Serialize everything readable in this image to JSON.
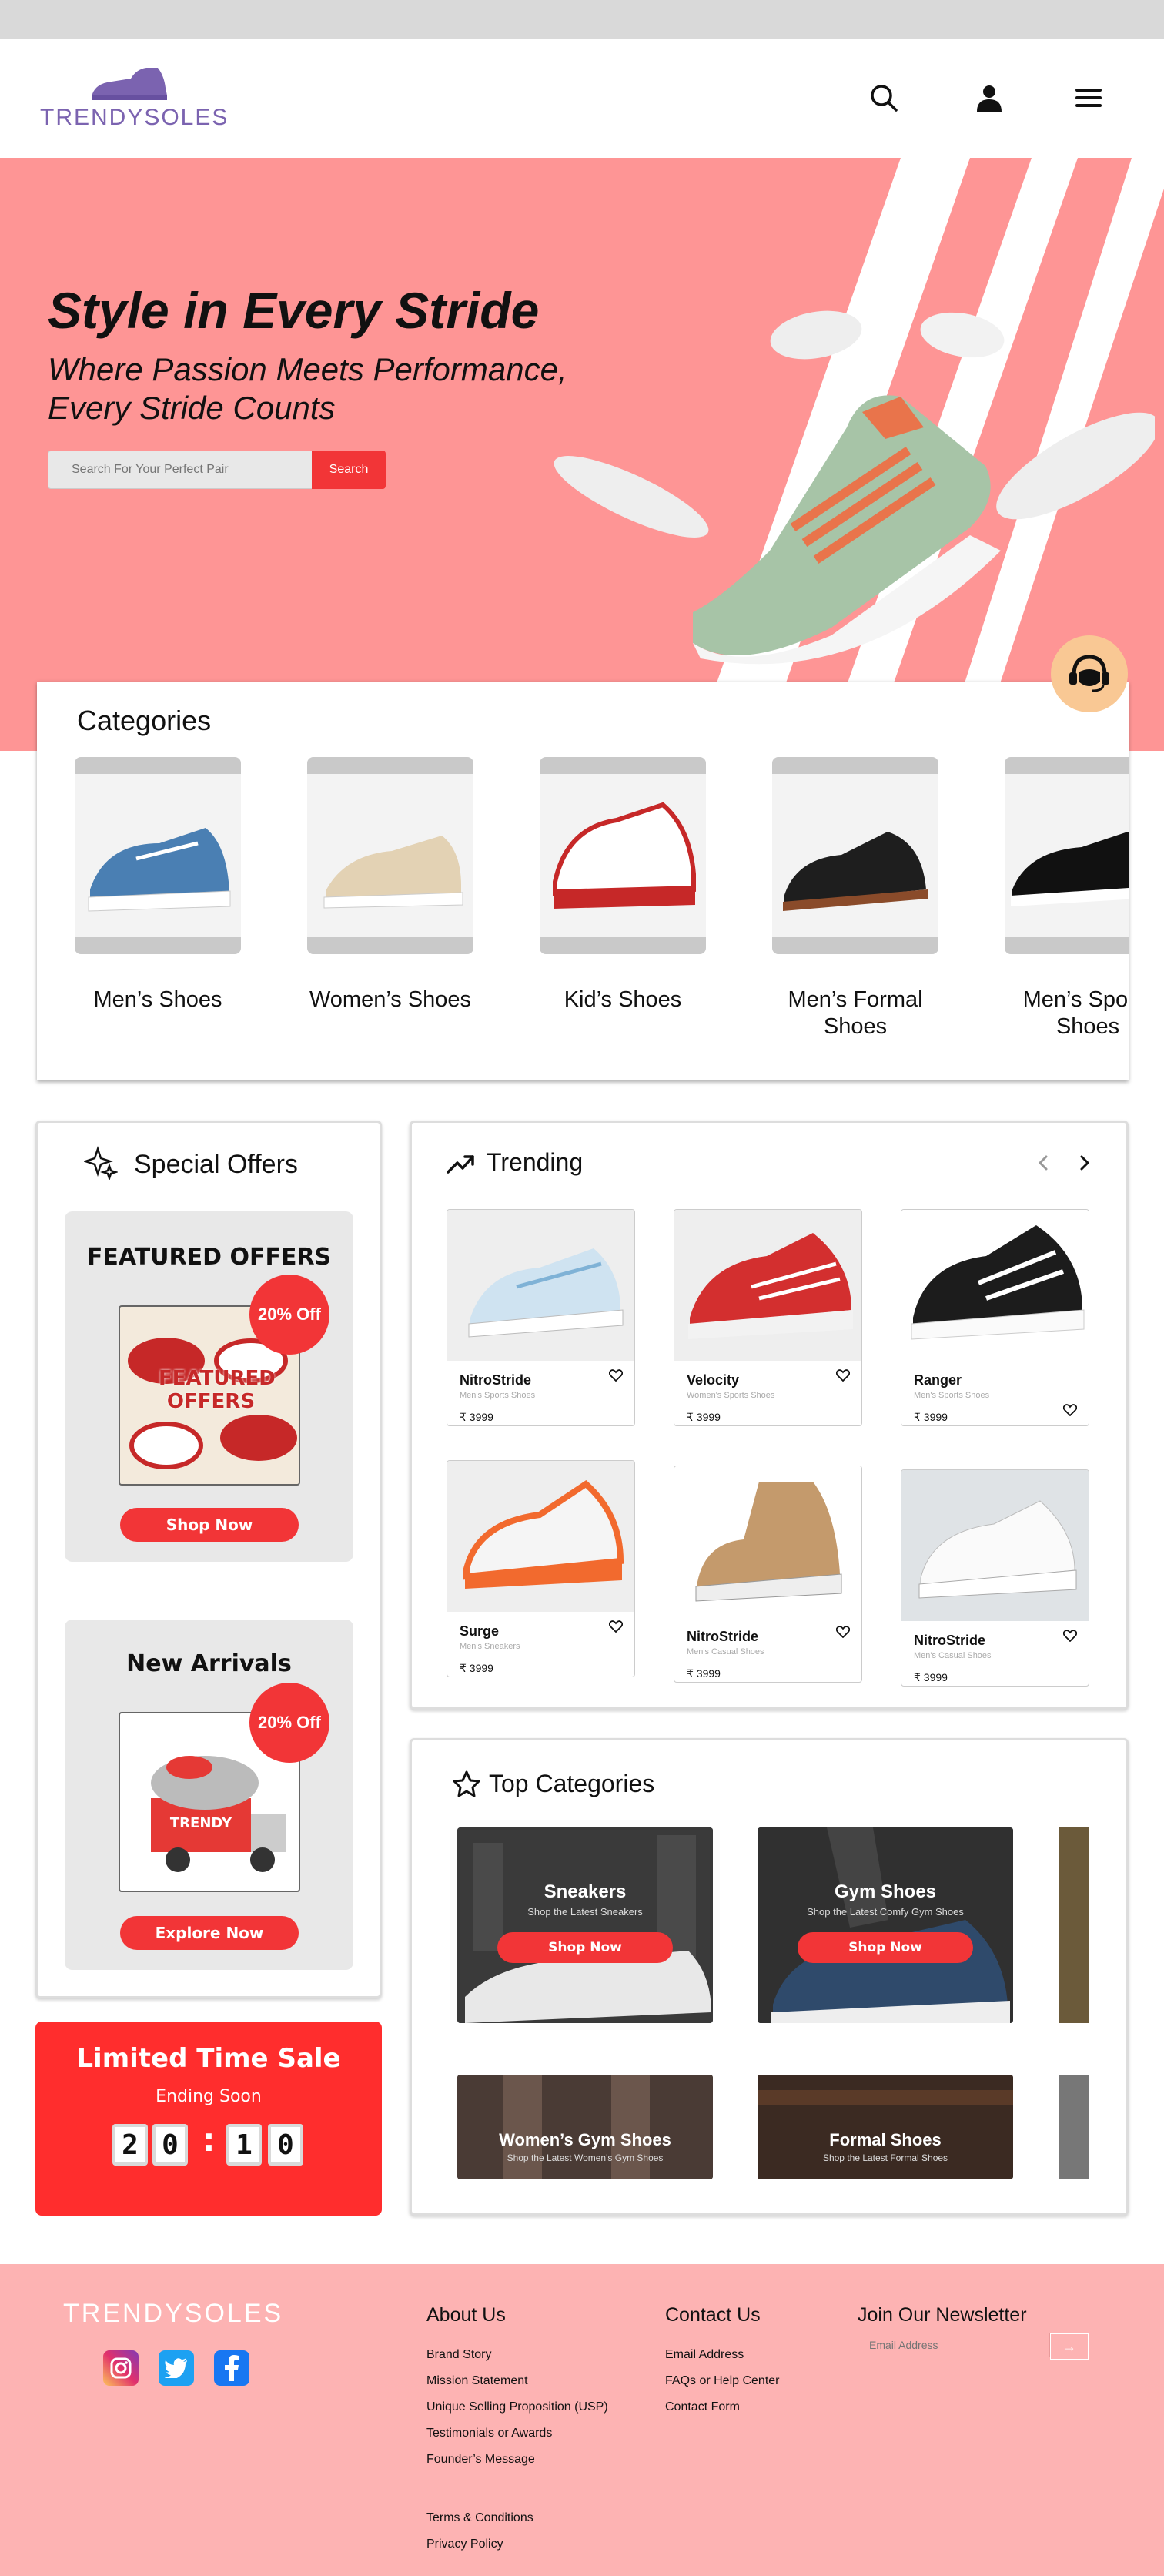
{
  "brand": {
    "name": "TRENDYSOLES",
    "accent": "#7b63b0"
  },
  "colors": {
    "hero_bg": "#fe9595",
    "primary_red": "#f23537",
    "footer_bg": "#fdb3b3"
  },
  "header": {
    "icons": [
      "search-icon",
      "user-icon",
      "menu-icon"
    ]
  },
  "hero": {
    "title": "Style in Every Stride",
    "subtitle": "Where Passion Meets Performance, Every Stride Counts",
    "search_placeholder": "Search For Your Perfect Pair",
    "search_button": "Search"
  },
  "categories": {
    "title": "Categories",
    "items": [
      {
        "label": "Men’s Shoes"
      },
      {
        "label": "Women’s Shoes"
      },
      {
        "label": "Kid’s Shoes"
      },
      {
        "label": "Men’s Formal Shoes"
      },
      {
        "label": "Men’s Sports Shoes"
      }
    ]
  },
  "special_offers": {
    "title": "Special Offers",
    "featured": {
      "title": "FEATURED OFFERS",
      "badge": "20% Off",
      "image_text": "FEATURED OFFERS",
      "button": "Shop Now"
    },
    "new_arrivals": {
      "title": "New Arrivals",
      "badge": "20% Off",
      "image_text": "TRENDY",
      "button": "Explore Now"
    }
  },
  "sale": {
    "title": "Limited Time Sale",
    "subtitle": "Ending Soon",
    "digits": [
      "2",
      "0",
      "1",
      "0"
    ],
    "separator": ":"
  },
  "trending": {
    "title": "Trending",
    "products": [
      {
        "name": "NitroStride",
        "sub": "Men's Sports Shoes",
        "price": "₹ 3999"
      },
      {
        "name": "Velocity",
        "sub": "Women's Sports Shoes",
        "price": "₹ 3999"
      },
      {
        "name": "Ranger",
        "sub": "Men's Sports Shoes",
        "price": "₹ 3999"
      },
      {
        "name": "Surge",
        "sub": "Men's Sneakers",
        "price": "₹ 3999"
      },
      {
        "name": "NitroStride",
        "sub": "Men's Casual Shoes",
        "price": "₹ 3999"
      },
      {
        "name": "NitroStride",
        "sub": "Men's Casual Shoes",
        "price": "₹ 3999"
      }
    ]
  },
  "top_categories": {
    "title": "Top Categories",
    "items": [
      {
        "name": "Sneakers",
        "sub": "Shop the Latest Sneakers",
        "button": "Shop Now"
      },
      {
        "name": "Gym Shoes",
        "sub": "Shop the Latest Comfy Gym Shoes",
        "button": "Shop Now"
      },
      {
        "name": "Women’s Gym Shoes",
        "sub": "Shop the Latest Women's Gym Shoes"
      },
      {
        "name": "Formal Shoes",
        "sub": "Shop the Latest Formal Shoes"
      }
    ]
  },
  "footer": {
    "brand": "TRENDYSOLES",
    "social": [
      "instagram-icon",
      "twitter-icon",
      "facebook-icon"
    ],
    "about": {
      "title": "About Us",
      "links": [
        "Brand Story",
        "Mission Statement",
        "Unique Selling Proposition (USP)",
        "Testimonials or Awards",
        "Founder’s Message"
      ]
    },
    "legal": [
      "Terms & Conditions",
      "Privacy Policy"
    ],
    "contact": {
      "title": "Contact Us",
      "links": [
        "Email Address",
        "FAQs or Help Center",
        "Contact Form"
      ]
    },
    "newsletter": {
      "title": "Join Our Newsletter",
      "placeholder": "Email Address"
    }
  }
}
